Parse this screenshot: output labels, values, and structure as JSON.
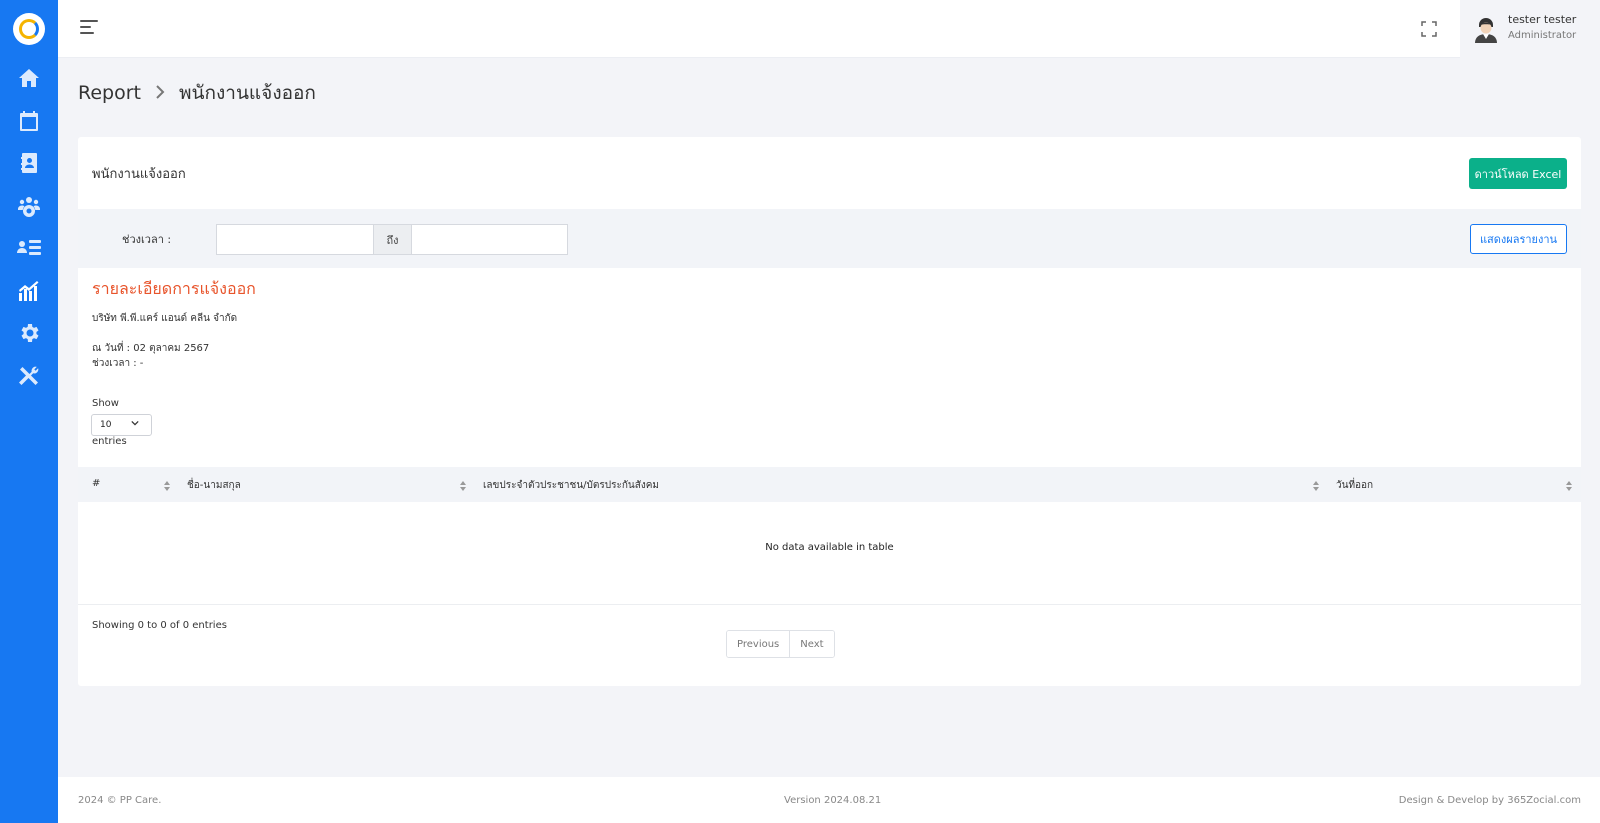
{
  "sidebar": {
    "items": [
      {
        "icon": "home-icon"
      },
      {
        "icon": "payroll-calendar-icon"
      },
      {
        "icon": "employee-contact-icon"
      },
      {
        "icon": "team-gear-icon"
      },
      {
        "icon": "user-list-icon"
      },
      {
        "icon": "report-chart-icon"
      },
      {
        "icon": "settings-icon"
      },
      {
        "icon": "tools-icon"
      }
    ]
  },
  "header": {
    "user_name": "tester tester",
    "user_role": "Administrator"
  },
  "breadcrumb": {
    "root": "Report",
    "current": "พนักงานแจ้งออก"
  },
  "card": {
    "title": "พนักงานแจ้งออก",
    "download_button": "ดาวน์โหลด Excel"
  },
  "filter": {
    "label": "ช่วงเวลา :",
    "from_value": "",
    "separator": "ถึง",
    "to_value": "",
    "show_button": "แสดงผลรายงาน"
  },
  "report": {
    "title": "รายละเอียดการแจ้งออก",
    "company": "บริษัท พี.พี.แคร์ แอนด์ คลีน จำกัด",
    "as_of": "ณ วันที่ : 02 ตุลาคม 2567",
    "period": "ช่วงเวลา : -"
  },
  "table": {
    "show_label": "Show",
    "page_size": "10",
    "entries_label": "entries",
    "columns": [
      "#",
      "ชื่อ-นามสกุล",
      "เลขประจำตัวประชาชน/บัตรประกันสังคม",
      "วันที่ออก"
    ],
    "empty_message": "No data available in table",
    "summary": "Showing 0 to 0 of 0 entries",
    "prev_label": "Previous",
    "next_label": "Next"
  },
  "footer": {
    "copyright": "2024 © PP Care.",
    "version": "Version 2024.08.21",
    "credit": "Design & Develop by 365Zocial.com"
  },
  "colors": {
    "sidebar": "#1778f2",
    "accent_green": "#0bb08a",
    "report_title": "#e8542b"
  }
}
